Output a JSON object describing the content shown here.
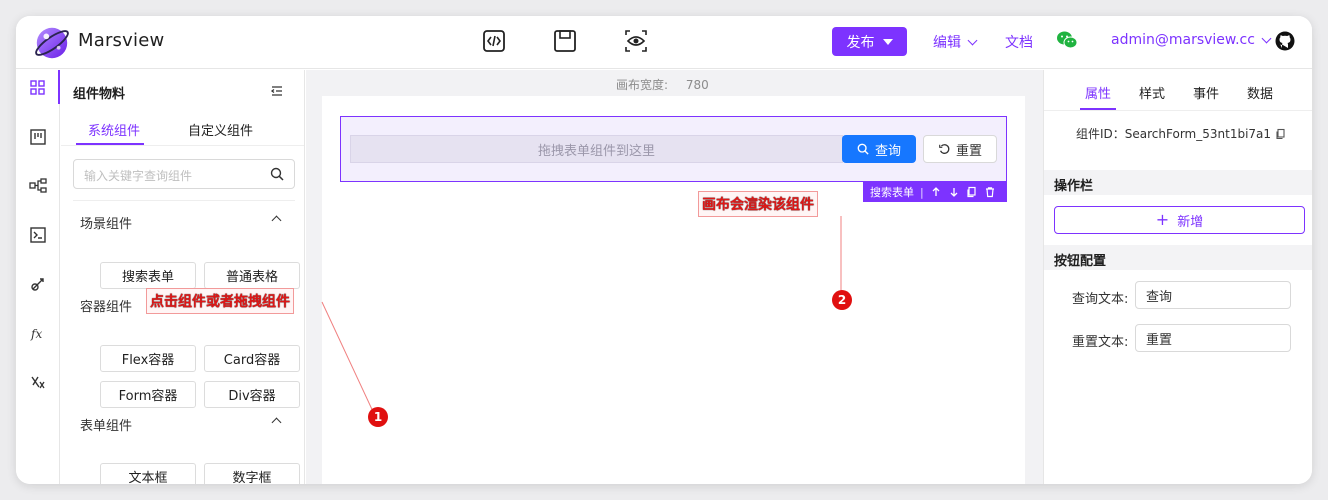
{
  "header": {
    "brand": "Marsview",
    "publish_label": "发布",
    "edit_label": "编辑",
    "docs_label": "文档",
    "user_label": "admin@marsview.cc",
    "icons": [
      "code-icon",
      "save-icon",
      "preview-icon",
      "wechat-icon",
      "github-icon"
    ]
  },
  "rail": {
    "icons": [
      "components-icon",
      "outline-icon",
      "flow-icon",
      "terminal-icon",
      "api-icon",
      "function-icon",
      "variables-icon"
    ]
  },
  "materials": {
    "title": "组件物料",
    "tabs": [
      "系统组件",
      "自定义组件"
    ],
    "search_placeholder": "输入关键字查询组件",
    "groups": [
      {
        "title": "场景组件",
        "items": [
          "搜索表单",
          "普通表格"
        ]
      },
      {
        "title": "容器组件",
        "items": [
          "Flex容器",
          "Card容器",
          "Form容器",
          "Div容器"
        ]
      },
      {
        "title": "表单组件",
        "items": [
          "文本框",
          "数字框"
        ]
      }
    ]
  },
  "canvas": {
    "width_label": "画布宽度:",
    "width_value": "780",
    "drop_hint": "拖拽表单组件到这里",
    "query_label": "查询",
    "reset_label": "重置",
    "selected_name": "搜索表单",
    "separator": "|"
  },
  "annotations": {
    "note1": "点击组件或者拖拽组件",
    "note2": "画布会渲染该组件",
    "dot1": "1",
    "dot2": "2"
  },
  "props": {
    "tabs": [
      "属性",
      "样式",
      "事件",
      "数据"
    ],
    "component_id": "组件ID：SearchForm_53nt1bi7a1",
    "section_actions": "操作栏",
    "add_label": "新增",
    "section_buttons": "按钮配置",
    "query_text_label": "查询文本:",
    "query_text_value": "查询",
    "reset_text_label": "重置文本:",
    "reset_text_value": "重置"
  },
  "colors": {
    "accent": "#7d33ff",
    "primary_button": "#1677ff",
    "annotation": "#e01616"
  }
}
